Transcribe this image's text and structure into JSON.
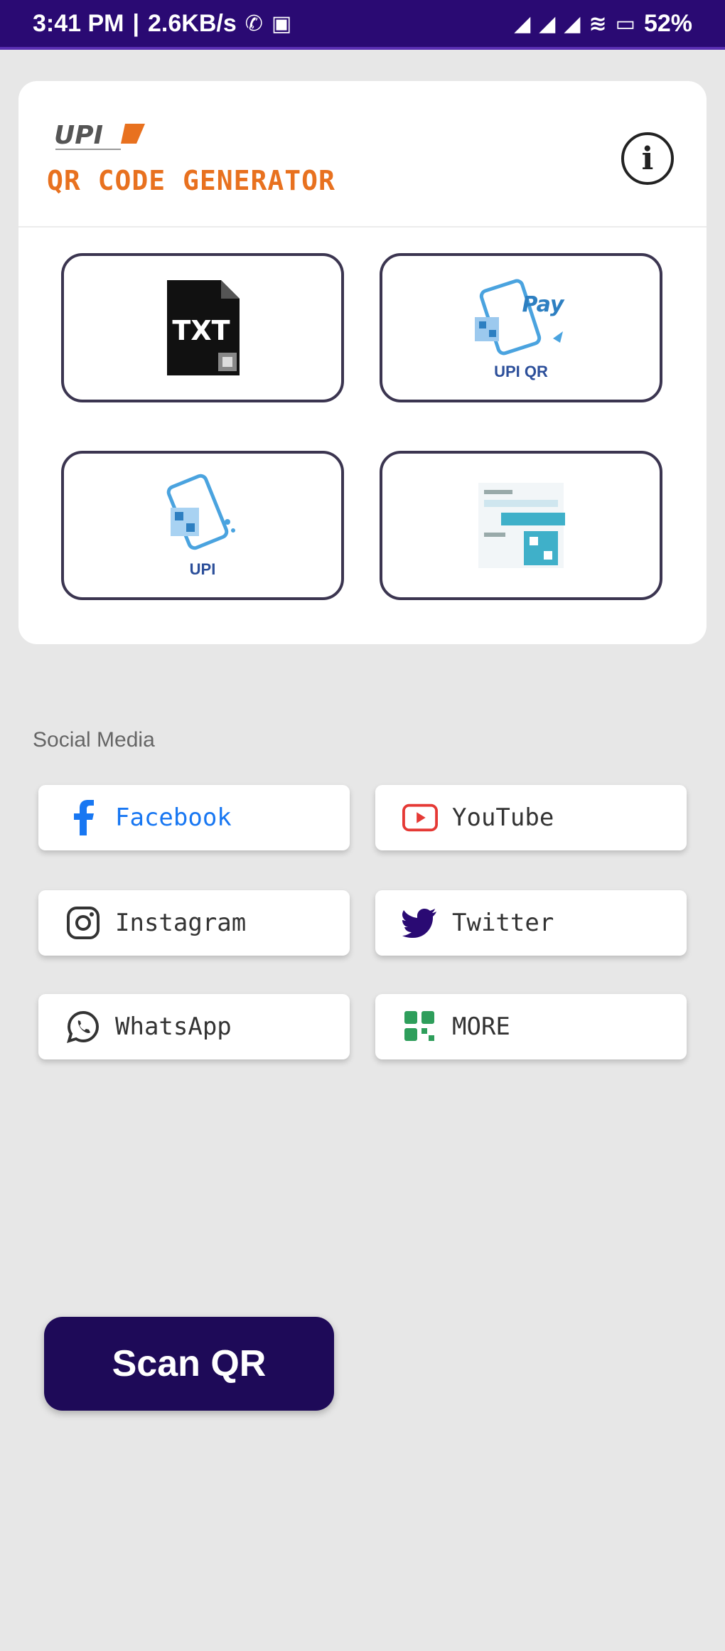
{
  "status_bar": {
    "time": "3:41 PM",
    "speed": "2.6KB/s",
    "battery": "52%"
  },
  "header": {
    "logo_text": "UPI",
    "app_title": "QR CODE GENERATOR",
    "info_label": "i"
  },
  "tiles": [
    {
      "name": "text-qr",
      "icon": "txt-file-icon",
      "caption": "",
      "icon_text": "TXT"
    },
    {
      "name": "upi-qr",
      "icon": "upi-phone-qr-icon",
      "caption": "UPI QR"
    },
    {
      "name": "upi",
      "icon": "phone-qr-icon",
      "caption": "UPI"
    },
    {
      "name": "form-qr",
      "icon": "form-qr-icon",
      "caption": ""
    }
  ],
  "social": {
    "section_label": "Social Media",
    "items": [
      {
        "label": "Facebook",
        "icon": "facebook-icon",
        "color": "#1877f2"
      },
      {
        "label": "YouTube",
        "icon": "youtube-icon",
        "color": "#e53935"
      },
      {
        "label": "Instagram",
        "icon": "instagram-icon",
        "color": "#333333"
      },
      {
        "label": "Twitter",
        "icon": "twitter-icon",
        "color": "#2a0a73"
      },
      {
        "label": "WhatsApp",
        "icon": "whatsapp-icon",
        "color": "#333333"
      },
      {
        "label": "MORE",
        "icon": "more-grid-icon",
        "color": "#2e9e5b"
      }
    ]
  },
  "scan_button": {
    "label": "Scan QR"
  },
  "colors": {
    "status_bar": "#2a0a73",
    "accent_orange": "#e8711f",
    "scan_button": "#1e0a58"
  }
}
